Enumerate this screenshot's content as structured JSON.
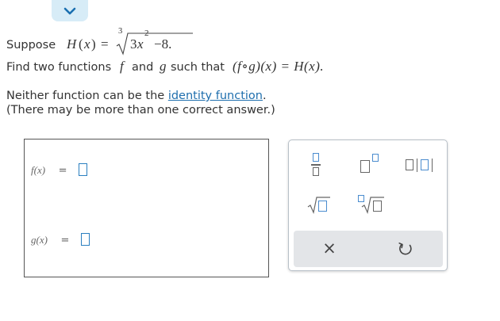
{
  "collapse_button": {
    "icon": "chevron-down-icon"
  },
  "problem": {
    "suppose": "Suppose",
    "h_name": "H",
    "x_var": "x",
    "equals": "=",
    "root_index": "3",
    "radicand_coef": "3",
    "radicand_exp": "2",
    "radicand_rest": "−8.",
    "find_text": "Find two functions",
    "f_name": "f",
    "and_text": "and",
    "g_name": "g",
    "such_that": "such that",
    "compose": "(f∘g)(x) = H(x).",
    "neither_text": "Neither function can be the",
    "identity_link": "identity function",
    "period": ".",
    "note": "(There may be more than one correct answer.)"
  },
  "answer": {
    "f_label": "f(x)",
    "g_label": "g(x)",
    "eq": "="
  },
  "palette": {
    "fraction_icon": "fraction-icon",
    "superscript_icon": "superscript-icon",
    "abs_value_icon": "absolute-value-icon",
    "sqrt_icon": "square-root-icon",
    "nth_root_icon": "nth-root-icon",
    "clear_symbol": "×",
    "reset_symbol": "↻"
  }
}
